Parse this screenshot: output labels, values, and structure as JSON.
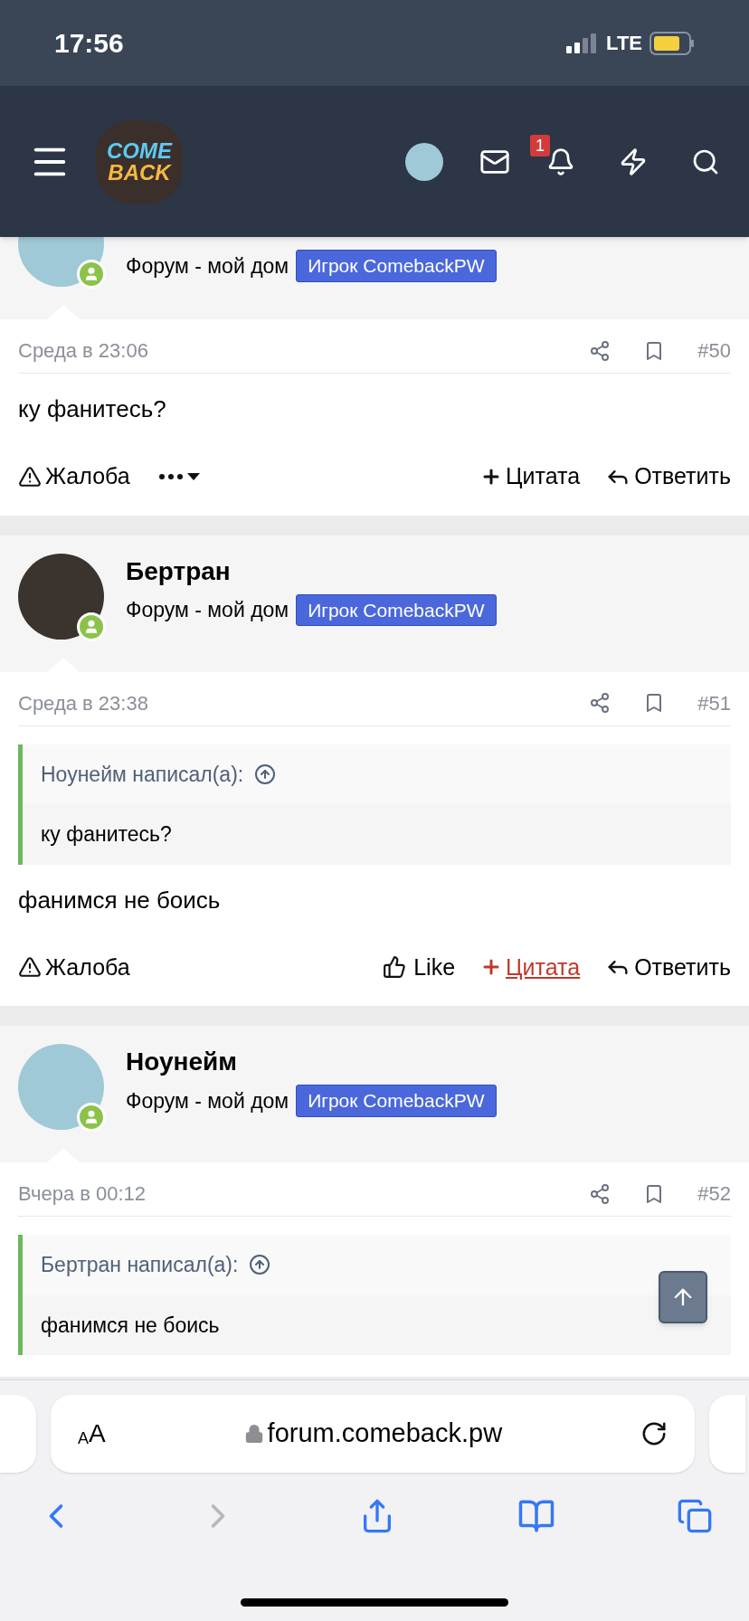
{
  "status_bar": {
    "time": "17:56",
    "network": "LTE"
  },
  "header": {
    "logo": {
      "line_1": "COME",
      "line_2": "BACK"
    },
    "notification_count": "1"
  },
  "posts": [
    {
      "avatar": {
        "kind": "cartoon"
      },
      "online": true,
      "signature": "Форум - мой дом",
      "badge": "Игрок ComebackPW",
      "date": "Среда в 23:06",
      "number": "#50",
      "message": "ку фанитесь?",
      "actions": [
        {
          "kind": "report",
          "label": "Жалоба",
          "highlighted": false
        },
        {
          "kind": "more",
          "highlighted": false
        },
        {
          "kind": "quote",
          "label": "Цитата",
          "highlighted": false
        },
        {
          "kind": "reply",
          "label": "Ответить",
          "highlighted": false
        }
      ]
    },
    {
      "author": "Бертран",
      "avatar": {
        "kind": "photo"
      },
      "online": true,
      "signature": "Форум - мой дом",
      "badge": "Игрок ComebackPW",
      "date": "Среда в 23:38",
      "number": "#51",
      "quote": {
        "source": "Ноунейм написал(а):",
        "text": "ку фанитесь?"
      },
      "message": "фанимся не боись",
      "actions": [
        {
          "kind": "report",
          "label": "Жалоба",
          "highlighted": false
        },
        {
          "kind": "like",
          "label": "Like",
          "highlighted": false
        },
        {
          "kind": "quote",
          "label": "Цитата",
          "highlighted": true
        },
        {
          "kind": "reply",
          "label": "Ответить",
          "highlighted": false
        }
      ]
    },
    {
      "author": "Ноунейм",
      "avatar": {
        "kind": "cartoon"
      },
      "online": true,
      "signature": "Форум - мой дом",
      "badge": "Игрок ComebackPW",
      "date": "Вчера в 00:12",
      "number": "#52",
      "quote": {
        "source": "Бертран написал(а):",
        "text": "фанимся не боись"
      }
    }
  ],
  "browser": {
    "text_size_small": "A",
    "text_size_large": "A",
    "url": "forum.comeback.pw",
    "back_enabled": true,
    "forward_enabled": false
  }
}
